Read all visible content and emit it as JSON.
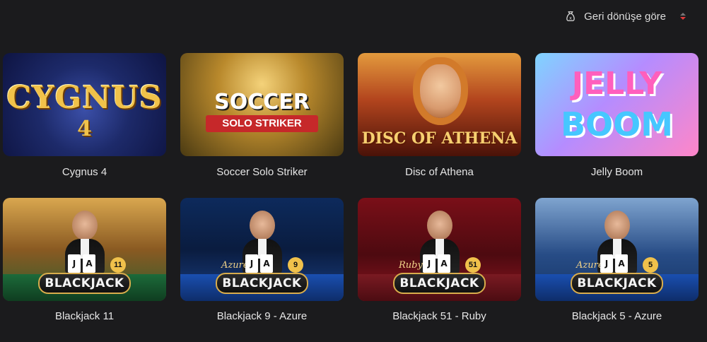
{
  "sort": {
    "label": "Geri dönüşe göre",
    "icon": "sort-bag-icon",
    "accent": "#e03a3a"
  },
  "games": [
    {
      "title": "Cygnus 4",
      "art_text": [
        "CYGNUS",
        "4"
      ]
    },
    {
      "title": "Soccer Solo Striker",
      "art_text": [
        "SOCCER",
        "SOLO STRIKER"
      ]
    },
    {
      "title": "Disc of Athena",
      "art_text": [
        "DISC OF ATHENA"
      ]
    },
    {
      "title": "Jelly Boom",
      "art_text": [
        "JELLY",
        "BOOM"
      ]
    },
    {
      "title": "Blackjack 11",
      "badge": "11",
      "banner": "BLACKJACK",
      "cards": [
        "J",
        "A"
      ]
    },
    {
      "title": "Blackjack 9 - Azure",
      "badge": "9",
      "banner": "BLACKJACK",
      "variant": "Azure",
      "cards": [
        "J",
        "A"
      ]
    },
    {
      "title": "Blackjack 51 - Ruby",
      "badge": "51",
      "banner": "BLACKJACK",
      "variant": "Ruby",
      "cards": [
        "J",
        "A"
      ]
    },
    {
      "title": "Blackjack 5 - Azure",
      "badge": "5",
      "banner": "BLACKJACK",
      "variant": "Azure",
      "cards": [
        "J",
        "A"
      ]
    }
  ]
}
